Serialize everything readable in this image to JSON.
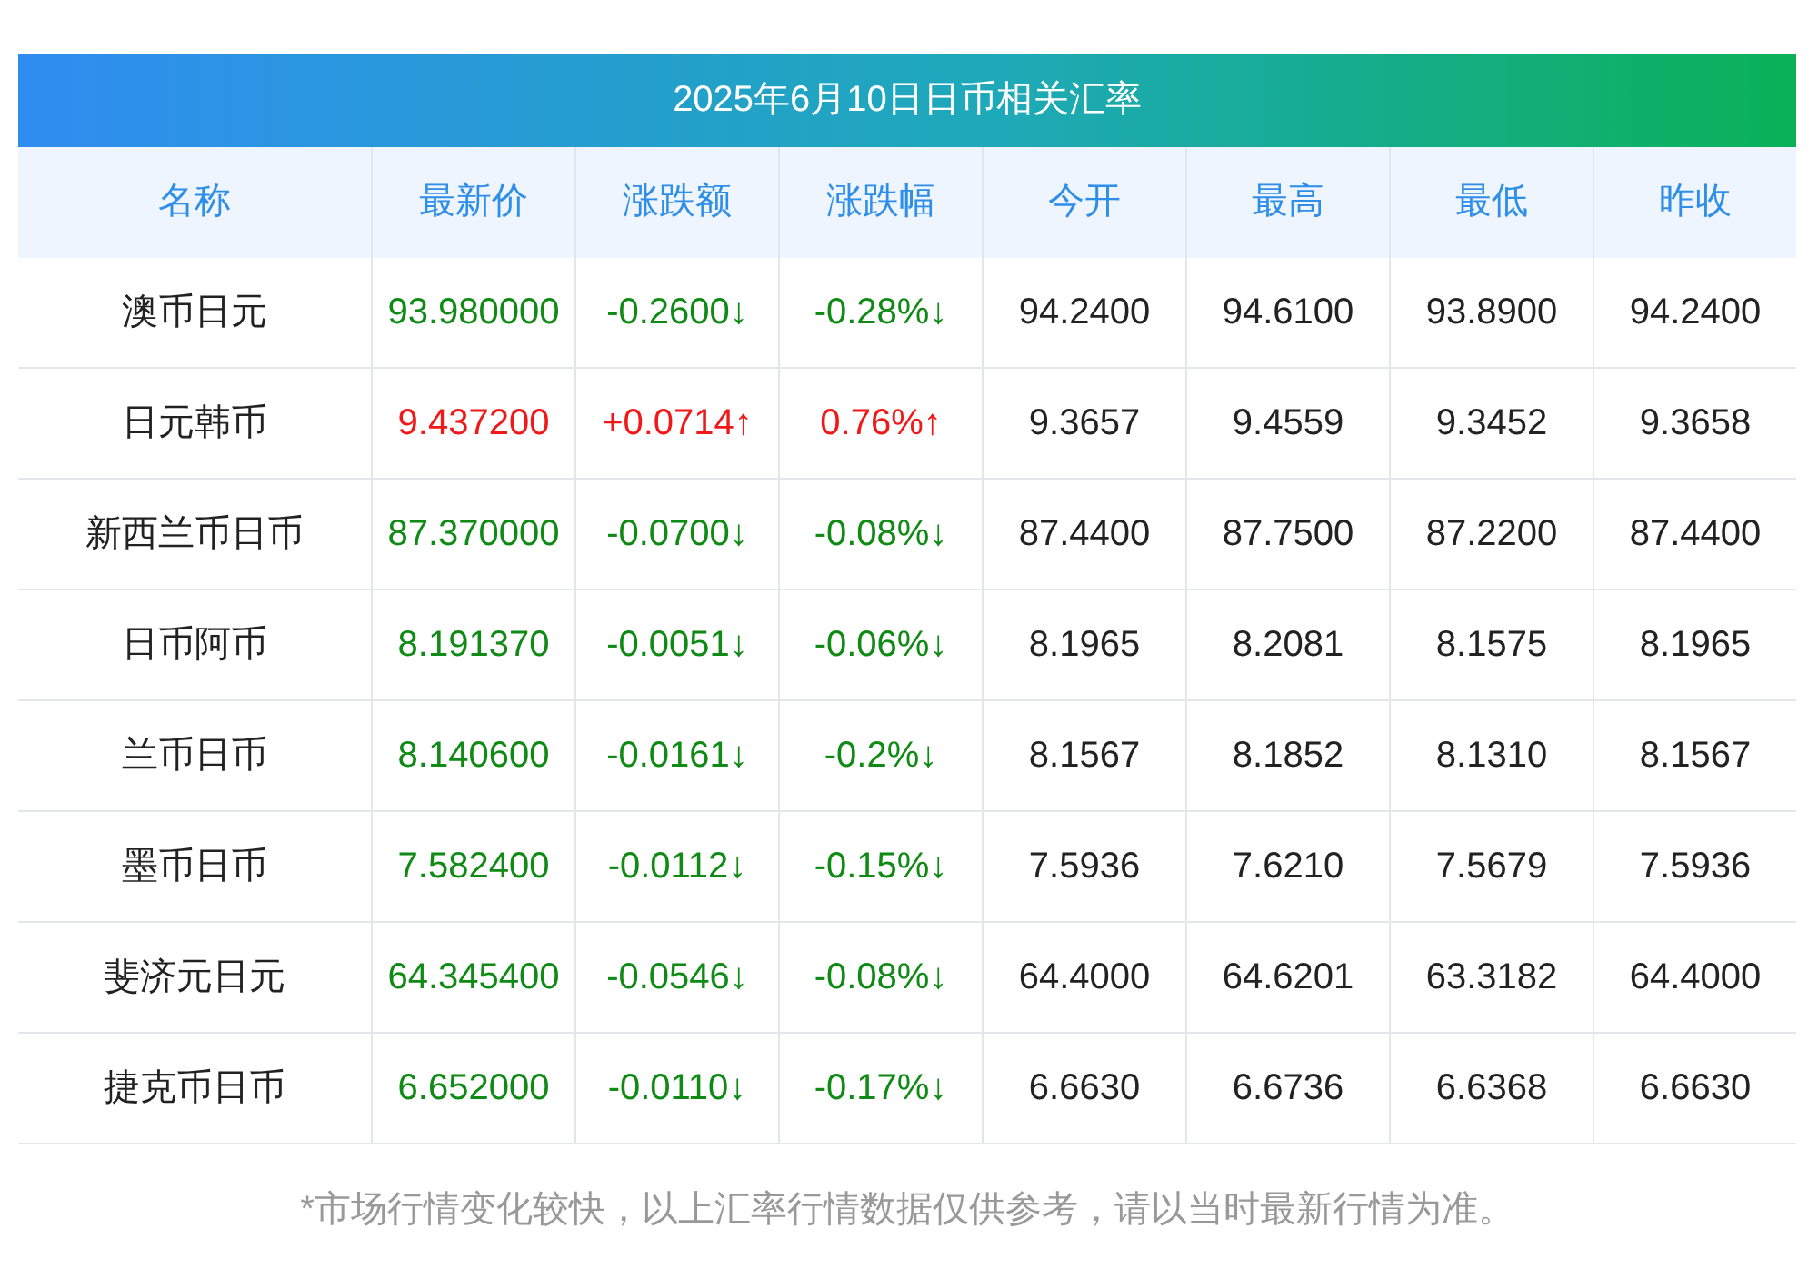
{
  "title": "2025年6月10日日币相关汇率",
  "columns": [
    "名称",
    "最新价",
    "涨跌额",
    "涨跌幅",
    "今开",
    "最高",
    "最低",
    "昨收"
  ],
  "rows": [
    {
      "kind": "down",
      "cells": [
        "澳币日元",
        "93.980000",
        "-0.2600↓",
        "-0.28%↓",
        "94.2400",
        "94.6100",
        "93.8900",
        "94.2400"
      ]
    },
    {
      "kind": "up",
      "cells": [
        "日元韩币",
        "9.437200",
        "+0.0714↑",
        "0.76%↑",
        "9.3657",
        "9.4559",
        "9.3452",
        "9.3658"
      ]
    },
    {
      "kind": "down",
      "cells": [
        "新西兰币日币",
        "87.370000",
        "-0.0700↓",
        "-0.08%↓",
        "87.4400",
        "87.7500",
        "87.2200",
        "87.4400"
      ]
    },
    {
      "kind": "down",
      "cells": [
        "日币阿币",
        "8.191370",
        "-0.0051↓",
        "-0.06%↓",
        "8.1965",
        "8.2081",
        "8.1575",
        "8.1965"
      ]
    },
    {
      "kind": "down",
      "cells": [
        "兰币日币",
        "8.140600",
        "-0.0161↓",
        "-0.2%↓",
        "8.1567",
        "8.1852",
        "8.1310",
        "8.1567"
      ]
    },
    {
      "kind": "down",
      "cells": [
        "墨币日币",
        "7.582400",
        "-0.0112↓",
        "-0.15%↓",
        "7.5936",
        "7.6210",
        "7.5679",
        "7.5936"
      ]
    },
    {
      "kind": "down",
      "cells": [
        "斐济元日元",
        "64.345400",
        "-0.0546↓",
        "-0.08%↓",
        "64.4000",
        "64.6201",
        "63.3182",
        "64.4000"
      ]
    },
    {
      "kind": "down",
      "cells": [
        "捷克币日币",
        "6.652000",
        "-0.0110↓",
        "-0.17%↓",
        "6.6630",
        "6.6736",
        "6.6368",
        "6.6630"
      ]
    }
  ],
  "footnote": "*市场行情变化较快，以上汇率行情数据仅供参考，请以当时最新行情为准。"
}
